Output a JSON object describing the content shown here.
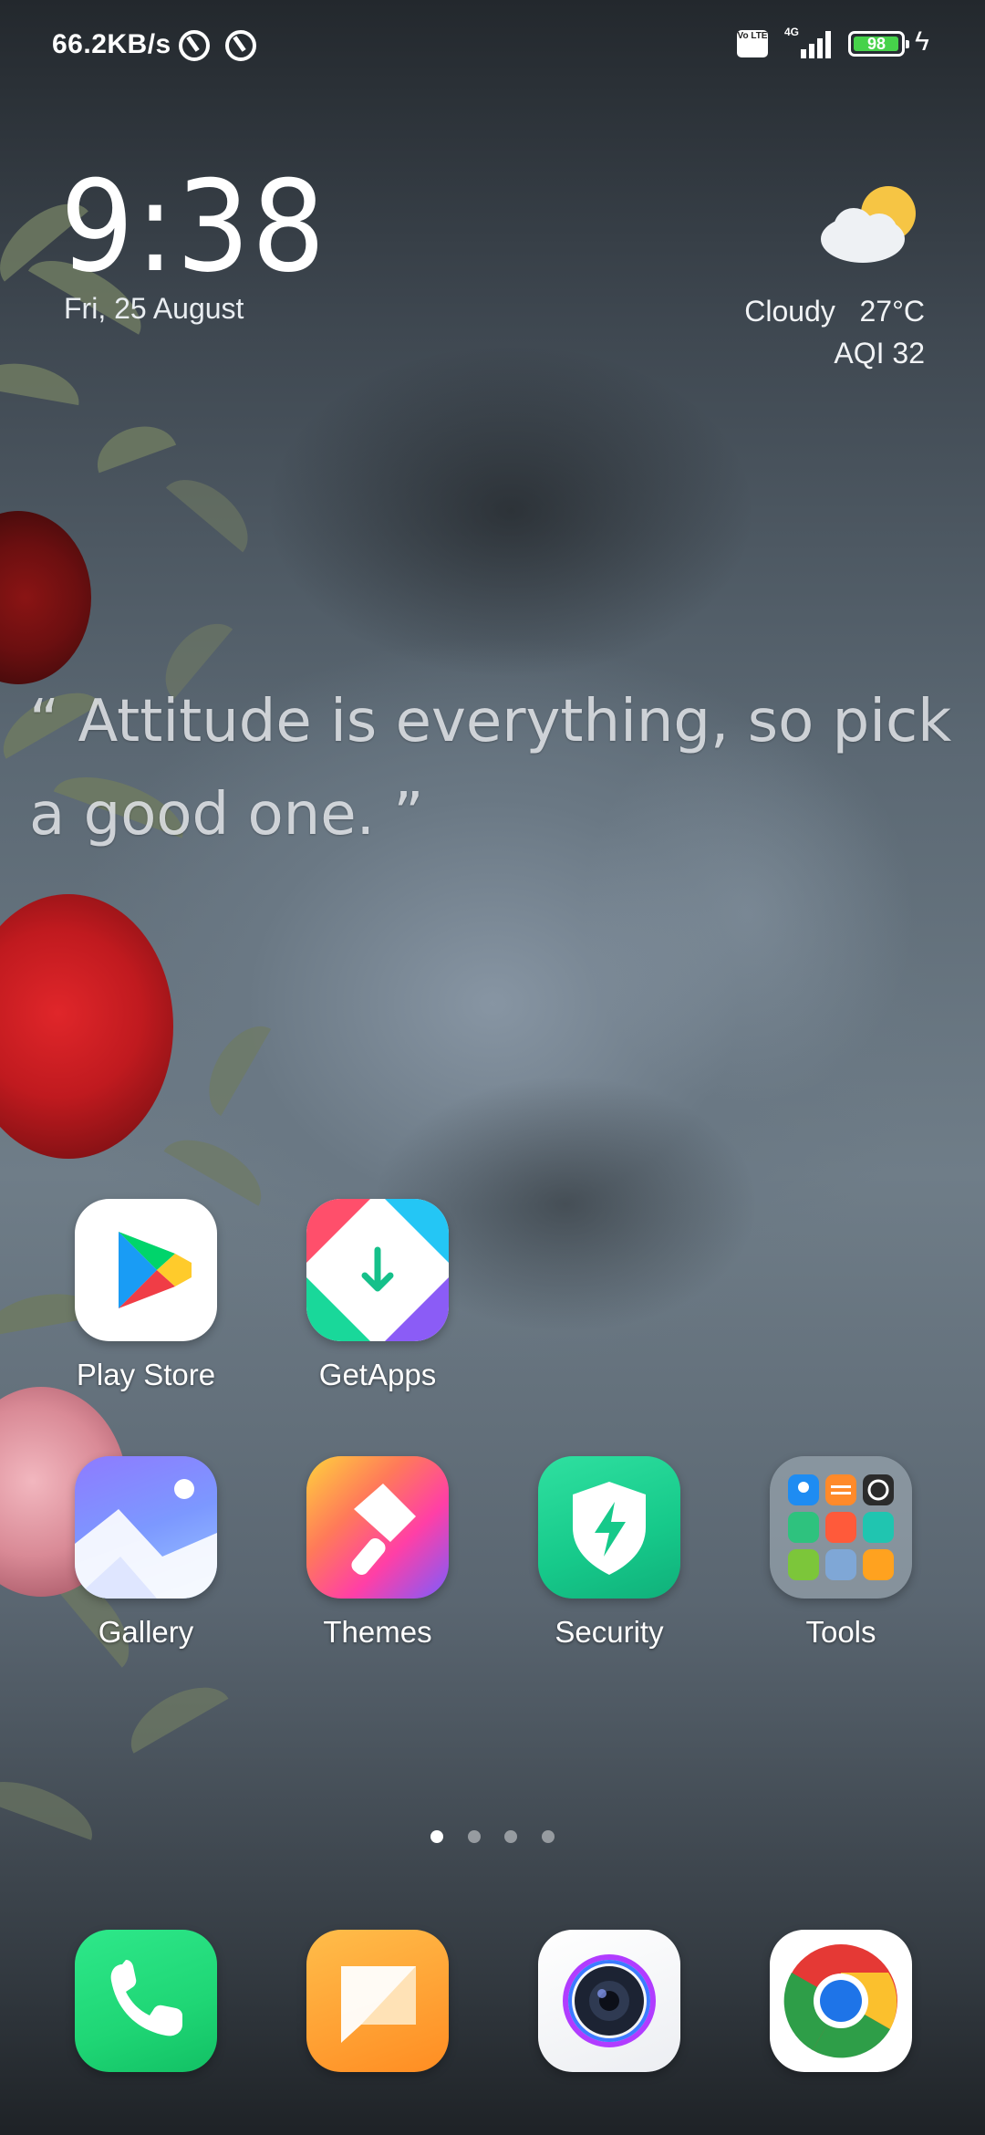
{
  "status_bar": {
    "net_speed": "66.2KB/s",
    "network_type": "4G",
    "volte": "Vo LTE",
    "battery_level": "98",
    "battery_fraction": 0.98,
    "charging": true
  },
  "clock": {
    "time": "9:38",
    "date": "Fri, 25 August"
  },
  "weather": {
    "condition": "Cloudy",
    "temperature": "27°C",
    "aqi": "AQI 32",
    "icon": "partly-cloudy-icon"
  },
  "quote": {
    "text": "“ Attitude is everything, so pick a good one. ”"
  },
  "apps": [
    {
      "label": "Play Store",
      "icon": "play-store-icon"
    },
    {
      "label": "GetApps",
      "icon": "getapps-icon"
    },
    {
      "label": "Gallery",
      "icon": "gallery-icon"
    },
    {
      "label": "Themes",
      "icon": "themes-icon"
    },
    {
      "label": "Security",
      "icon": "security-icon"
    },
    {
      "label": "Tools",
      "icon": "tools-folder-icon"
    }
  ],
  "page_indicator": {
    "pages": 4,
    "current": 1
  },
  "dock": [
    {
      "icon": "phone-icon"
    },
    {
      "icon": "messages-icon"
    },
    {
      "icon": "camera-icon"
    },
    {
      "icon": "chrome-icon"
    }
  ],
  "colors": {
    "battery_fill": "#46d24a",
    "phone_green": "#1fd675",
    "security_green": "#16c98a"
  }
}
